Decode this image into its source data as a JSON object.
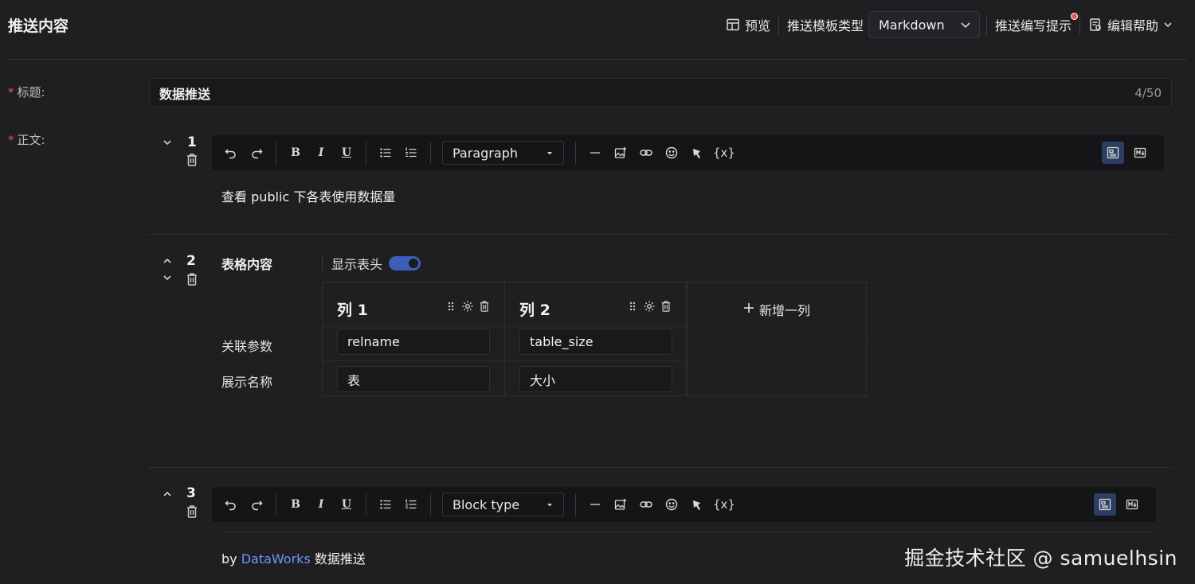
{
  "header": {
    "title": "推送内容",
    "preview_label": "预览",
    "template_type_label": "推送模板类型",
    "template_type_value": "Markdown",
    "tips_label": "推送编写提示",
    "help_label": "编辑帮助"
  },
  "form": {
    "title_label": "标题:",
    "title_value": "数据推送",
    "title_counter": "4/50",
    "body_label": "正文:"
  },
  "blocks": [
    {
      "number": "1",
      "block_type": "Paragraph",
      "text": "查看 public 下各表使用数据量"
    },
    {
      "number": "2",
      "table_title": "表格内容",
      "show_header_label": "显示表头",
      "show_header_on": true,
      "columns": [
        {
          "header": "列 1",
          "param": "relname",
          "display": "表"
        },
        {
          "header": "列 2",
          "param": "table_size",
          "display": "大小"
        }
      ],
      "row_labels": [
        "关联参数",
        "展示名称"
      ],
      "add_column_label": "新增一列"
    },
    {
      "number": "3",
      "block_type": "Block type",
      "text_prefix": "by ",
      "link_text": "DataWorks",
      "text_suffix": " 数据推送"
    }
  ],
  "toolbar": {
    "bold": "B",
    "italic": "I",
    "underline": "U",
    "variable": "{x}"
  },
  "watermark": "掘金技术社区 @ samuelhsin",
  "colors": {
    "background": "#1f1f22",
    "accent": "#3b5fb8",
    "link": "#6e95ff",
    "required": "#f05555"
  }
}
